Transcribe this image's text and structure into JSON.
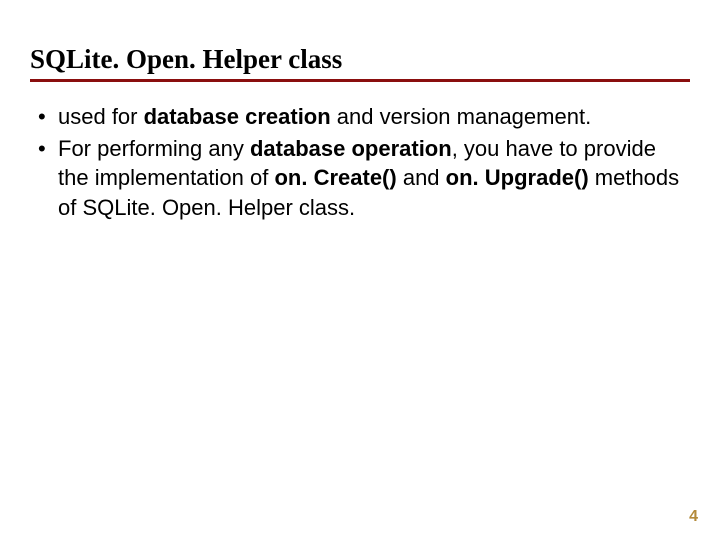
{
  "title": "SQLite. Open. Helper class",
  "bullets": [
    {
      "segments": [
        {
          "text": "used for ",
          "bold": false
        },
        {
          "text": "database creation",
          "bold": true
        },
        {
          "text": " and version management.",
          "bold": false
        }
      ]
    },
    {
      "segments": [
        {
          "text": "For performing any ",
          "bold": false
        },
        {
          "text": "database operation",
          "bold": true
        },
        {
          "text": ", you have to provide the implementation of ",
          "bold": false
        },
        {
          "text": "on. Create()",
          "bold": true
        },
        {
          "text": " and ",
          "bold": false
        },
        {
          "text": "on. Upgrade()",
          "bold": true
        },
        {
          "text": " methods of SQLite. Open. Helper class.",
          "bold": false
        }
      ]
    }
  ],
  "pageNumber": "4"
}
